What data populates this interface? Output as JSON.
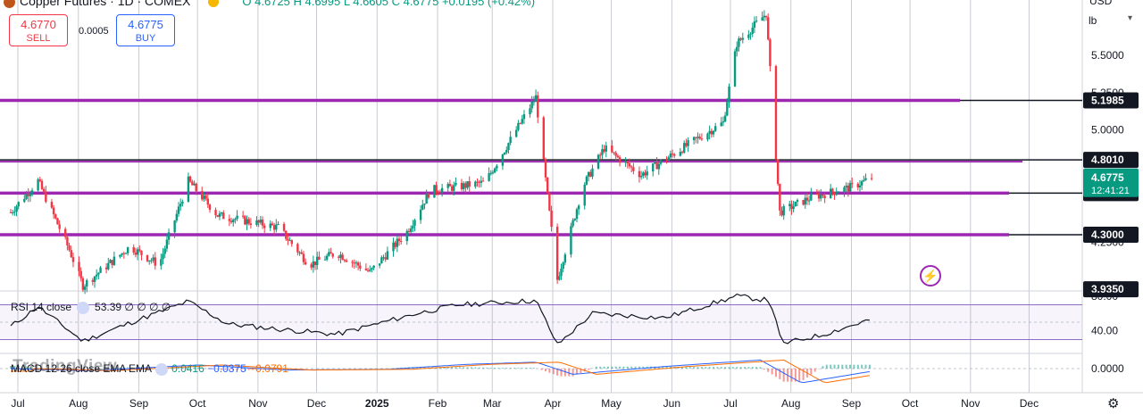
{
  "header": {
    "title": "Copper Futures · 1D · COMEX",
    "ohlc": "O 4.6725  H 4.6995  L 4.6605  C 4.6775  +0.0195 (+0.42%)",
    "currency": "USD",
    "unit": "lb"
  },
  "trade": {
    "sell_price": "4.6770",
    "sell_label": "SELL",
    "spread": "0.0005",
    "buy_price": "4.6775",
    "buy_label": "BUY"
  },
  "indicators": {
    "rsi_label": "RSI 14 close",
    "rsi_value": "53.39",
    "rsi_extra": "∅ ∅ ∅ ∅",
    "macd_label": "MACD 12 26 close EMA EMA",
    "macd_hist": "0.0416",
    "macd_line": "−0.0375",
    "macd_signal": "−0.0791"
  },
  "watermark": "TradingView",
  "colors": {
    "up": "#089981",
    "down": "#f23645",
    "level_line": "#9c27b0",
    "current_price_badge": "#089981"
  },
  "price_axis": {
    "ticks": [
      "5.5000",
      "5.2500",
      "5.0000",
      "4.2500"
    ],
    "rsi_ticks": [
      "80.00",
      "40.00"
    ],
    "macd_ticks": [
      "0.0000"
    ],
    "badges": [
      {
        "label": "5.1985",
        "price": 5.1985,
        "kind": "level"
      },
      {
        "label": "4.8010",
        "price": 4.801,
        "kind": "level"
      },
      {
        "label": "4.5785",
        "price": 4.5785,
        "kind": "level"
      },
      {
        "label": "4.3000",
        "price": 4.3,
        "kind": "level"
      },
      {
        "label": "3.9350",
        "price": 3.935,
        "kind": "level"
      }
    ],
    "current": {
      "price_label": "4.6775",
      "price": 4.6775,
      "countdown": "12:41:21"
    }
  },
  "time_axis": [
    "Jul",
    "Aug",
    "Sep",
    "Oct",
    "Nov",
    "Dec",
    "2025",
    "Feb",
    "Mar",
    "Apr",
    "May",
    "Jun",
    "Jul",
    "Aug",
    "Sep",
    "Oct",
    "Nov",
    "Dec"
  ],
  "chart_data": {
    "type": "candlestick",
    "x_range": [
      "2024-07-01",
      "2025-12-31"
    ],
    "ylim": [
      3.93,
      5.87
    ],
    "levels": [
      5.1985,
      4.801,
      4.5785,
      4.3
    ],
    "price_path": [
      [
        "2024-07-01",
        4.45
      ],
      [
        "2024-07-15",
        4.66
      ],
      [
        "2024-07-31",
        4.2
      ],
      [
        "2024-08-07",
        3.96
      ],
      [
        "2024-08-31",
        4.22
      ],
      [
        "2024-09-15",
        4.1
      ],
      [
        "2024-09-30",
        4.66
      ],
      [
        "2024-10-15",
        4.43
      ],
      [
        "2024-11-15",
        4.35
      ],
      [
        "2024-12-01",
        4.1
      ],
      [
        "2024-12-15",
        4.18
      ],
      [
        "2025-01-01",
        4.05
      ],
      [
        "2025-01-20",
        4.32
      ],
      [
        "2025-02-01",
        4.6
      ],
      [
        "2025-02-15",
        4.62
      ],
      [
        "2025-03-01",
        4.65
      ],
      [
        "2025-03-27",
        5.22
      ],
      [
        "2025-04-07",
        4.0
      ],
      [
        "2025-04-20",
        4.62
      ],
      [
        "2025-05-01",
        4.88
      ],
      [
        "2025-05-20",
        4.7
      ],
      [
        "2025-06-15",
        4.92
      ],
      [
        "2025-07-01",
        5.05
      ],
      [
        "2025-07-08",
        5.58
      ],
      [
        "2025-07-23",
        5.78
      ],
      [
        "2025-07-30",
        4.45
      ],
      [
        "2025-08-15",
        4.55
      ],
      [
        "2025-09-05",
        4.62
      ],
      [
        "2025-09-15",
        4.68
      ]
    ],
    "rsi_ylim": [
      15,
      85
    ],
    "rsi_path": [
      [
        "2024-07-01",
        45
      ],
      [
        "2024-07-15",
        68
      ],
      [
        "2024-08-07",
        28
      ],
      [
        "2024-09-01",
        50
      ],
      [
        "2024-09-30",
        74
      ],
      [
        "2024-10-20",
        48
      ],
      [
        "2024-11-15",
        42
      ],
      [
        "2024-12-15",
        36
      ],
      [
        "2025-01-25",
        60
      ],
      [
        "2025-02-15",
        70
      ],
      [
        "2025-03-27",
        75
      ],
      [
        "2025-04-07",
        24
      ],
      [
        "2025-04-25",
        60
      ],
      [
        "2025-06-01",
        55
      ],
      [
        "2025-07-08",
        80
      ],
      [
        "2025-07-25",
        75
      ],
      [
        "2025-07-31",
        25
      ],
      [
        "2025-08-20",
        35
      ],
      [
        "2025-09-15",
        53.39
      ]
    ],
    "macd_ylim": [
      -0.25,
      0.2
    ],
    "macd_path": [
      [
        "2024-07-01",
        0.0
      ],
      [
        "2024-08-10",
        -0.03
      ],
      [
        "2024-10-05",
        0.05
      ],
      [
        "2024-11-20",
        -0.02
      ],
      [
        "2025-01-10",
        -0.01
      ],
      [
        "2025-02-20",
        0.06
      ],
      [
        "2025-03-27",
        0.09
      ],
      [
        "2025-04-15",
        -0.08
      ],
      [
        "2025-06-01",
        0.03
      ],
      [
        "2025-07-20",
        0.12
      ],
      [
        "2025-08-10",
        -0.2
      ],
      [
        "2025-09-15",
        -0.0375
      ]
    ]
  }
}
